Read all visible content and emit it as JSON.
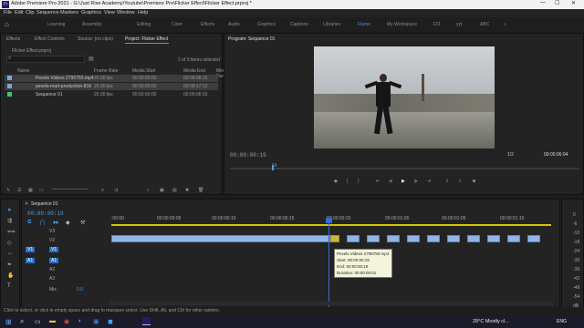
{
  "title": "Adobe Premiere Pro 2021 - G:\\Just Rise Academy\\Youtube\\Premiere Pro\\Flicker Effect\\Flicker Effect.prproj *",
  "window_controls": {
    "min": "—",
    "max": "☐",
    "close": "✕"
  },
  "menu": [
    "File",
    "Edit",
    "Clip",
    "Sequence",
    "Markers",
    "Graphics",
    "View",
    "Window",
    "Help"
  ],
  "workspaces": [
    "Learning",
    "Assembly",
    "Editing",
    "Color",
    "Effects",
    "Audio",
    "Graphics",
    "Captions",
    "Libraries",
    "Flame",
    "My Workspace",
    "123",
    "yyt",
    "ABC"
  ],
  "active_workspace": "Flame",
  "source_tabs": [
    "Effects",
    "Effect Controls",
    "Source: (no clips)",
    "Project: Flicker Effect"
  ],
  "project": {
    "name": "Flicker Effect.prproj",
    "items_selected": "2 of 3 items selected",
    "columns": [
      "Name",
      "Frame Rate",
      "Media Start",
      "Media End",
      "Media Duration"
    ],
    "rows": [
      {
        "name": "Pexels Videos 2795750.mp4",
        "fps": "25.00 fps",
        "start": "00:00:00:00",
        "end": "00:00:08:16",
        "selected": true
      },
      {
        "name": "pexels-mart-production-816",
        "fps": "25.00 fps",
        "start": "00:00:00:00",
        "end": "00:00:17:12",
        "selected": true
      },
      {
        "name": "Sequence 01",
        "fps": "25.00 fps",
        "start": "00:00:00:00",
        "end": "00:00:06:03",
        "selected": false
      }
    ]
  },
  "program": {
    "tab": "Program: Sequence 01",
    "timecode": "00:00:00:19",
    "fit": "Fit",
    "scale": "1/2",
    "duration": "00:00:06:04"
  },
  "timeline": {
    "tab": "Sequence 01",
    "timecode": "00:00:00:19",
    "ruler": [
      ":00:00",
      "00:00:00:05",
      "00:00:00:10",
      "00:00:00:15",
      "00:00:00:20",
      "00:00:01:00",
      "00:00:01:05",
      "00:00:01:10"
    ],
    "tracks_video": [
      "V3",
      "V2",
      "V1"
    ],
    "tracks_audio": [
      "A1",
      "A2",
      "A3"
    ],
    "mix": "Mix",
    "mix_val": "0.0",
    "left_badges": [
      "V1",
      "A1"
    ],
    "db": [
      "0",
      "-6",
      "-12",
      "-18",
      "-24",
      "-30",
      "-36",
      "-42",
      "-48",
      "-54"
    ],
    "db_label": "dB"
  },
  "tooltip": {
    "title": "Pexels Videos 2795750.mp4",
    "start": "Start: 00:00:00:19",
    "end": "End: 00:00:00:19",
    "duration": "Duration: 00:00:00:01"
  },
  "status": "Click to select, or click in empty space and drag to marquee select. Use Shift, Alt, and Ctrl for other options.",
  "taskbar": {
    "weather": "29°C  Mostly cl...",
    "lang": "ENG"
  },
  "colors": {
    "accent": "#4a9be6",
    "clip": "#8fb5e6",
    "playhead": "#2f6fd6"
  }
}
